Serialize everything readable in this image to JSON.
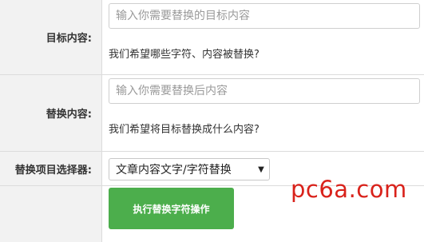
{
  "form": {
    "target": {
      "label": "目标内容:",
      "placeholder": "输入你需要替换的目标内容",
      "hint": "我们希望哪些字符、内容被替换?"
    },
    "replace": {
      "label": "替换内容:",
      "placeholder": "输入你需要替换后内容",
      "hint": "我们希望将目标替换成什么内容?"
    },
    "selector": {
      "label": "替换项目选择器:",
      "selected": "文章内容文字/字符替换",
      "arrow_icon": "triangle-down"
    },
    "execute_button_label": "执行替换字符操作"
  },
  "watermark": "pc6a.com",
  "colors": {
    "button_green": "#4cae4c",
    "label_bg": "#f2f2f2",
    "watermark_red": "#d9221b"
  }
}
